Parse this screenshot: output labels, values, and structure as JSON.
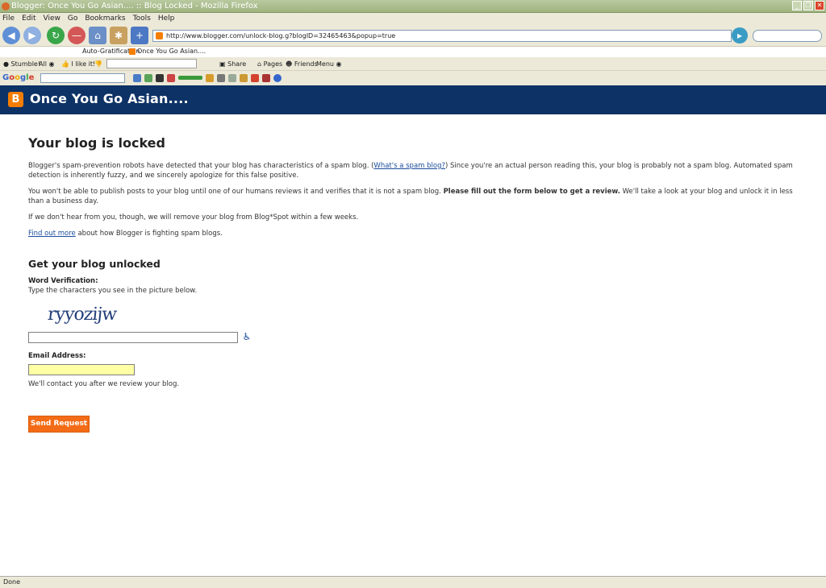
{
  "window": {
    "title": "Blogger: Once You Go Asian.... :: Blog Locked - Mozilla Firefox"
  },
  "menu": [
    "File",
    "Edit",
    "View",
    "Go",
    "Bookmarks",
    "Tools",
    "Help"
  ],
  "nav": {
    "url": "http://www.blogger.com/unlock-blog.g?blogID=32465463&popup=true"
  },
  "tabs": [
    {
      "label": "Auto-Gratification"
    },
    {
      "label": "Once You Go Asian...."
    }
  ],
  "stumble": {
    "stumble_label": "Stumble!",
    "all_label": "All",
    "like_label": "I like it!",
    "share_label": "Share",
    "pages_label": "Pages",
    "friends_label": "Friends",
    "menu_label": "Menu"
  },
  "google": {
    "logo": "Google",
    "pagerank": "PageRank"
  },
  "blog": {
    "title": "Once You Go Asian....",
    "logo_letter": "B"
  },
  "page": {
    "heading": "Your blog is locked",
    "p1_before": "Blogger's spam-prevention robots have detected that your blog has characteristics of a spam blog. (",
    "p1_link": "What's a spam blog?",
    "p1_after": ") Since you're an actual person reading this, your blog is probably not a spam blog. Automated spam detection is inherently fuzzy, and we sincerely apologize for this false positive.",
    "p2_before": "You won't be able to publish posts to your blog until one of our humans reviews it and verifies that it is not a spam blog. ",
    "p2_bold": "Please fill out the form below to get a review.",
    "p2_after": " We'll take a look at your blog and unlock it in less than a business day.",
    "p3": "If we don't hear from you, though, we will remove your blog from Blog*Spot within a few weeks.",
    "p4_link": "Find out more",
    "p4_after": " about how Blogger is fighting spam blogs.",
    "subheading": "Get your blog unlocked",
    "word_label": "Word Verification:",
    "word_hint": "Type the characters you see in the picture below.",
    "captcha_text": "ryyozijw",
    "word_value": "",
    "email_label": "Email Address:",
    "email_value": "",
    "contact_note": "We'll contact you after we review your blog.",
    "send_label": "Send Request"
  },
  "status": {
    "text": "Done"
  },
  "colors": {
    "header_bg": "#0d3265",
    "accent": "#f36b16",
    "link": "#1a4c9c"
  }
}
